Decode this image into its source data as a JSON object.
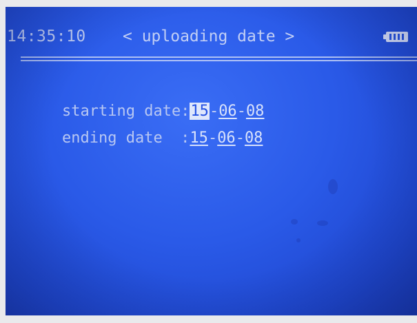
{
  "header": {
    "time": "14:35:10",
    "title": "< uploading date >",
    "battery_icon": "battery-full-icon"
  },
  "form": {
    "starting": {
      "label": "starting date:",
      "year": "15",
      "month": "06",
      "day": "08",
      "sep1": "-",
      "sep2": "-"
    },
    "ending": {
      "label": "ending date  :",
      "year": "15",
      "month": "06",
      "day": "08",
      "sep1": "-",
      "sep2": "-"
    }
  },
  "colors": {
    "screen_background": "#2a5ae8",
    "text": "#b9c8f4",
    "highlight_background": "#dfe7fc"
  }
}
